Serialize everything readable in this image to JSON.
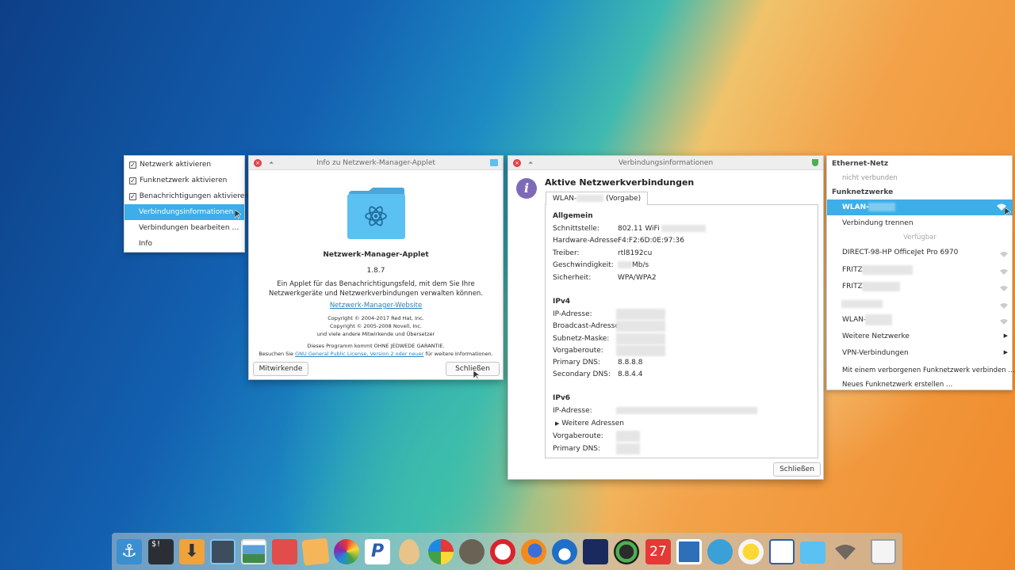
{
  "tray_menu": {
    "items": [
      {
        "label": "Netzwerk aktivieren",
        "checked": true
      },
      {
        "label": "Funknetzwerk aktivieren",
        "checked": true
      },
      {
        "label": "Benachrichtigungen aktivieren",
        "checked": true
      },
      {
        "label": "Verbindungsinformationen",
        "highlighted": true
      },
      {
        "label": "Verbindungen bearbeiten …"
      },
      {
        "label": "Info"
      }
    ]
  },
  "about_window": {
    "title": "Info zu Netzwerk-Manager-Applet",
    "app_name": "Netzwerk-Manager-Applet",
    "version": "1.8.7",
    "description": "Ein Applet für das Benachrichtigungsfeld, mit dem Sie Ihre Netzwerkgeräte und Netzwerkverbindungen verwalten können.",
    "website_link": "Netzwerk-Manager-Website",
    "copyright_1": "Copyright © 2004-2017 Red Hat, Inc.",
    "copyright_2": "Copyright © 2005-2008 Novell, Inc.",
    "copyright_3": "und viele andere Mitwirkende und Übersetzer",
    "warranty": "Dieses Programm kommt OHNE JEDWEDE GARANTIE.",
    "license_prefix": "Besuchen Sie",
    "license_link": "GNU General Public License, Version 2 oder neuer",
    "license_suffix": "für weitere Informationen.",
    "credits_button": "Mitwirkende",
    "close_button": "Schließen",
    "icon_color": "#5bc0f2"
  },
  "conn_window": {
    "title": "Verbindungsinformationen",
    "heading": "Aktive Netzwerkverbindungen",
    "tab_prefix": "WLAN-",
    "tab_suffix": "(Vorgabe)",
    "general_header": "Allgemein",
    "general": [
      {
        "label": "Schnittstelle:",
        "value": "802.11 WiFi"
      },
      {
        "label": "Hardware-Adresse:",
        "value": "F4:F2:6D:0E:97:36"
      },
      {
        "label": "Treiber:",
        "value": "rtl8192cu"
      },
      {
        "label": "Geschwindigkeit:",
        "value": "Mb/s"
      },
      {
        "label": "Sicherheit:",
        "value": "WPA/WPA2"
      }
    ],
    "ipv4_header": "IPv4",
    "ipv4": [
      {
        "label": "IP-Adresse:",
        "value": ""
      },
      {
        "label": "Broadcast-Adresse:",
        "value": ""
      },
      {
        "label": "Subnetz-Maske:",
        "value": ""
      },
      {
        "label": "Vorgaberoute:",
        "value": ""
      },
      {
        "label": "Primary DNS:",
        "value": "8.8.8.8"
      },
      {
        "label": "Secondary DNS:",
        "value": "8.8.4.4"
      }
    ],
    "ipv6_header": "IPv6",
    "ipv6_ip_label": "IP-Adresse:",
    "ipv6_more": "Weitere Adressen",
    "ipv6_route_label": "Vorgaberoute:",
    "ipv6_dns_label": "Primary DNS:",
    "close_button": "Schließen"
  },
  "network_menu": {
    "ethernet_header": "Ethernet-Netz",
    "ethernet_status": "nicht verbunden",
    "wifi_header": "Funknetzwerke",
    "active_network": "WLAN-",
    "disconnect": "Verbindung trennen",
    "available_header": "Verfügbar",
    "networks": [
      "DIRECT-98-HP OfficeJet Pro 6970",
      "FRITZ!",
      "FRITZ!",
      "",
      "WLAN-"
    ],
    "more_networks": "Weitere Netzwerke",
    "vpn": "VPN-Verbindungen",
    "hidden_connect": "Mit einem verborgenen Funknetzwerk verbinden …",
    "new_network": "Neues Funknetzwerk erstellen …",
    "highlight_color": "#3daee9"
  },
  "dock": {
    "calendar_day": "27",
    "icons": [
      "anchor-icon",
      "terminal-icon",
      "download-icon",
      "screenshot-icon",
      "image-viewer-icon",
      "photos-icon",
      "image-editor-icon",
      "color-picker-icon",
      "pycharm-icon",
      "egg-icon",
      "pinwheel-icon",
      "gimp-icon",
      "opera-icon",
      "firefox-icon",
      "thunderbird-icon",
      "video-icon",
      "camera-icon",
      "calendar-icon",
      "window-icon",
      "sphere-icon",
      "sun-icon",
      "monitor-icon",
      "folder-icon",
      "wifi-icon",
      "trash-icon"
    ]
  }
}
